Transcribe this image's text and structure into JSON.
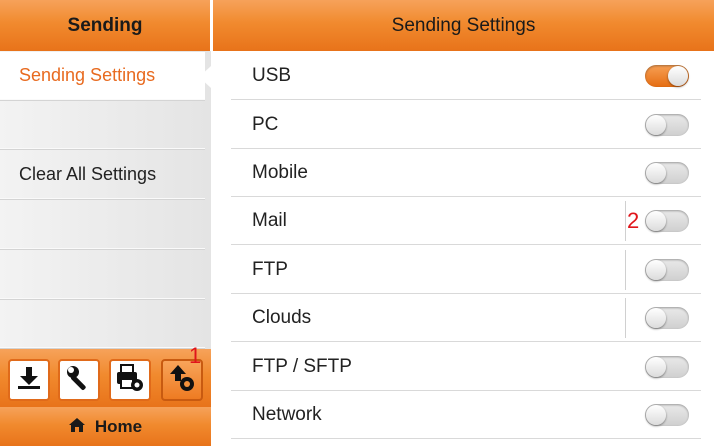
{
  "left_panel": {
    "title": "Sending",
    "menu": [
      {
        "label": "Sending Settings",
        "active": true
      },
      {
        "label": ""
      },
      {
        "label": "Clear All Settings"
      },
      {
        "label": ""
      },
      {
        "label": ""
      },
      {
        "label": ""
      }
    ],
    "toolbar": [
      {
        "icon": "download-icon"
      },
      {
        "icon": "wrench-icon"
      },
      {
        "icon": "printer-gear-icon"
      },
      {
        "icon": "send-gear-icon",
        "selected": true
      }
    ],
    "badge": "1",
    "home_label": "Home",
    "home_icon": "home-icon"
  },
  "right_panel": {
    "title": "Sending Settings",
    "badge": "2",
    "options": [
      {
        "label": "USB",
        "on": true
      },
      {
        "label": "PC",
        "on": false
      },
      {
        "label": "Mobile",
        "on": false
      },
      {
        "label": "Mail",
        "on": false
      },
      {
        "label": "FTP",
        "on": false
      },
      {
        "label": "Clouds",
        "on": false
      },
      {
        "label": "FTP / SFTP",
        "on": false
      },
      {
        "label": "Network",
        "on": false
      }
    ]
  },
  "colors": {
    "accent": "#f18a2e",
    "active_text": "#e86a1f",
    "badge": "#e0151b"
  }
}
